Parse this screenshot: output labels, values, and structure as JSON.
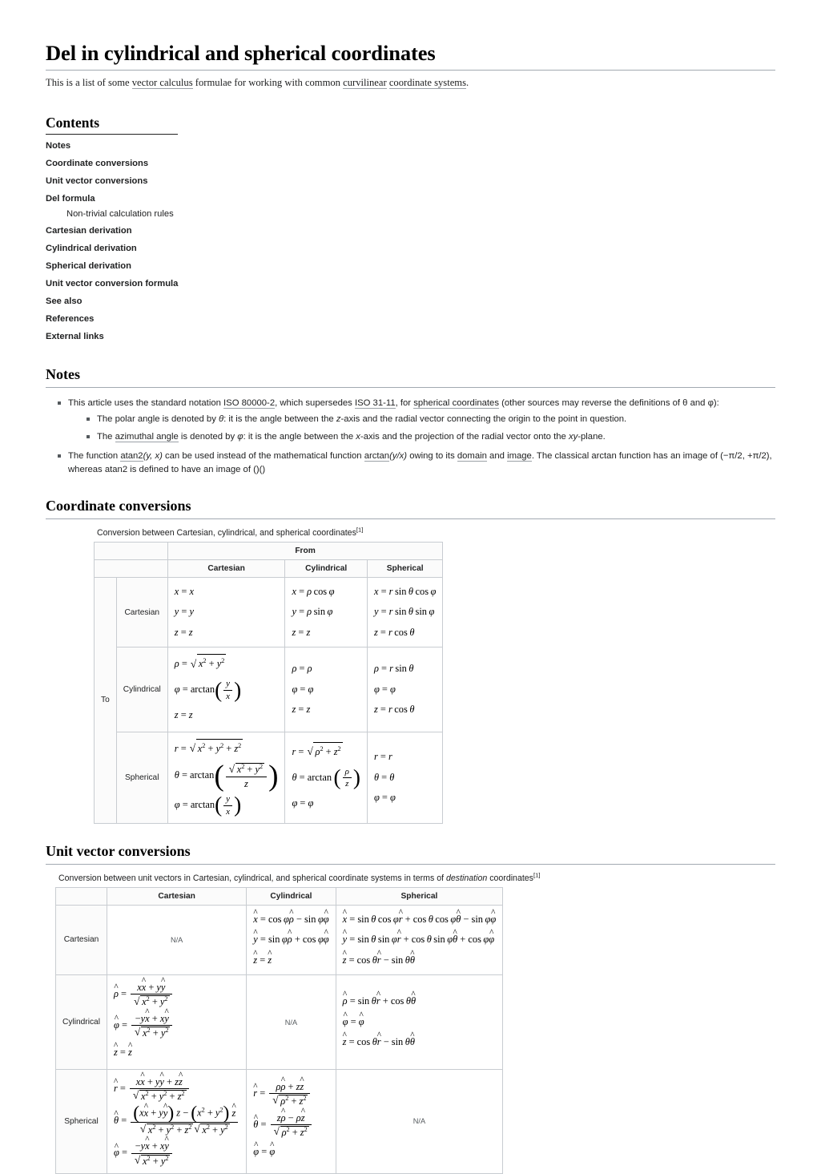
{
  "article": {
    "title": "Del in cylindrical and spherical coordinates",
    "lead_parts": [
      "This is a list of some ",
      "vector calculus",
      " formulae for working with common ",
      "curvilinear",
      " ",
      "coordinate systems",
      "."
    ]
  },
  "toc": {
    "heading": "Contents",
    "items": [
      {
        "label": "Notes",
        "level": 1
      },
      {
        "label": "Coordinate conversions",
        "level": 1
      },
      {
        "label": "Unit vector conversions",
        "level": 1
      },
      {
        "label": "Del formula",
        "level": 1
      },
      {
        "label": "Non-trivial calculation rules",
        "level": 2
      },
      {
        "label": "Cartesian derivation",
        "level": 1
      },
      {
        "label": "Cylindrical derivation",
        "level": 1
      },
      {
        "label": "Spherical derivation",
        "level": 1
      },
      {
        "label": "Unit vector conversion formula",
        "level": 1
      },
      {
        "label": "See also",
        "level": 1
      },
      {
        "label": "References",
        "level": 1
      },
      {
        "label": "External links",
        "level": 1
      }
    ]
  },
  "notes": {
    "heading": "Notes",
    "b1_a": "This article uses the standard notation ",
    "b1_iso1": "ISO 80000-2",
    "b1_b": ", which supersedes ISO 31-11, for ",
    "b1_link": "spherical coordinates",
    "b1_c": " (other sources may reverse the definitions of θ and φ):",
    "b1_iso2": "ISO 31-11",
    "sub1_a": "The polar angle is denoted by ",
    "sub1_sym": "θ",
    "sub1_b": ": it is the angle between the ",
    "sub1_z": "z",
    "sub1_c": "-axis and the radial vector connecting the origin to the point in question.",
    "sub2_a": "The ",
    "sub2_link": "azimuthal angle",
    "sub2_b": " is denoted by ",
    "sub2_sym": "φ",
    "sub2_c": ": it is the angle between the ",
    "sub2_x": "x",
    "sub2_d": "-axis and the projection of the radial vector onto the ",
    "sub2_xy": "xy",
    "sub2_e": "-plane.",
    "b2_a": "The function ",
    "b2_atan2": "atan2",
    "b2_args": "(y, x)",
    "b2_b": " can be used instead of the mathematical function ",
    "b2_arctan": "arctan",
    "b2_args2": "(y/x)",
    "b2_c": " owing to its ",
    "b2_domain": "domain",
    "b2_d": " and ",
    "b2_image": "image",
    "b2_e": ". The classical arctan function has an image of (−π/2, +π/2), whereas atan2 is defined to have an image of ()()"
  },
  "coord": {
    "heading": "Coordinate conversions",
    "caption": "Conversion between Cartesian, cylindrical, and spherical coordinates",
    "caption_ref": "[1]",
    "from_label": "From",
    "to_label": "To",
    "col_headers": [
      "Cartesian",
      "Cylindrical",
      "Spherical"
    ],
    "row_headers": [
      "Cartesian",
      "Cylindrical",
      "Spherical"
    ]
  },
  "unitvec": {
    "heading": "Unit vector conversions",
    "caption_a": "Conversion between unit vectors in Cartesian, cylindrical, and spherical coordinate systems in terms of ",
    "caption_em": "destination",
    "caption_b": " coordinates",
    "caption_ref": "[1]",
    "col_headers": [
      "Cartesian",
      "Cylindrical",
      "Spherical"
    ],
    "row_headers": [
      "Cartesian",
      "Cylindrical",
      "Spherical"
    ],
    "na": "N/A"
  }
}
